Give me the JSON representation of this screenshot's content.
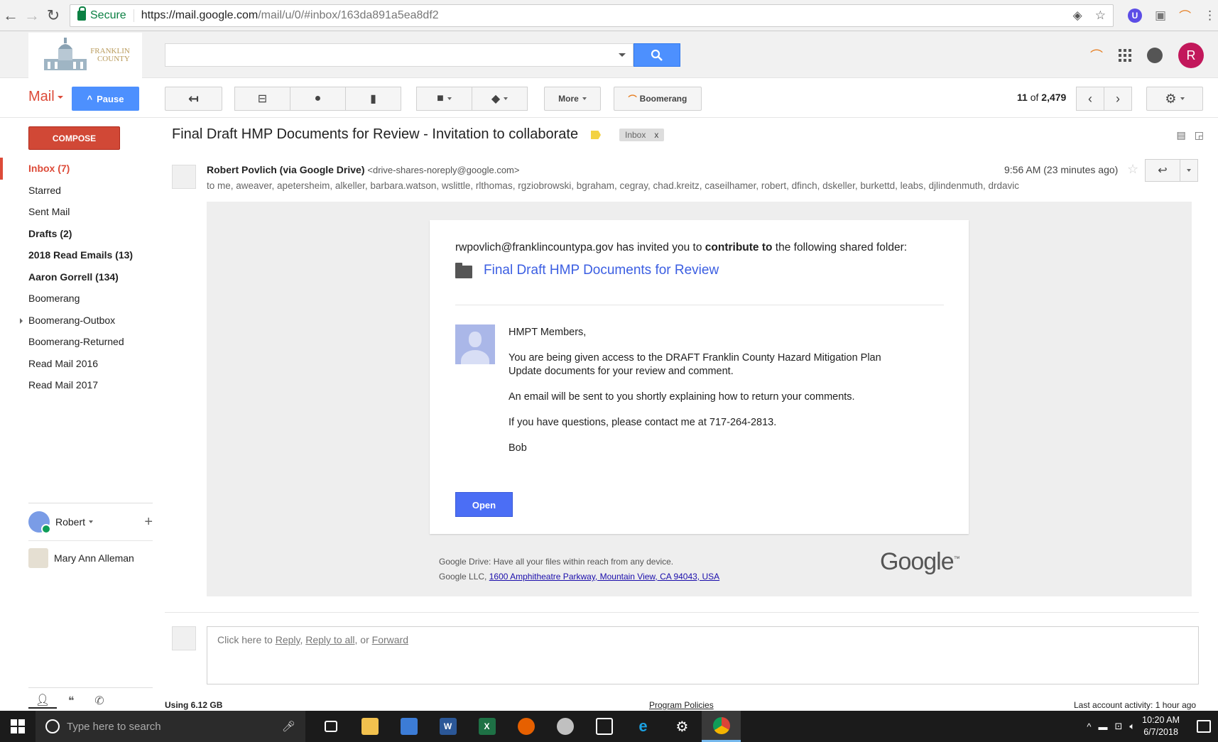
{
  "browser": {
    "secure_label": "Secure",
    "url_host": "https://mail.google.com",
    "url_path": "/mail/u/0/#inbox/163da891a5ea8df2"
  },
  "header": {
    "logo_text_1": "FRANKLIN",
    "logo_text_2": "COUNTY",
    "search_placeholder": "",
    "avatar_letter": "R"
  },
  "toolbar": {
    "mail_label": "Mail",
    "pause_label": "Pause",
    "more_label": "More",
    "boomerang_label": "Boomerang",
    "pager_current": "11",
    "pager_of": "of",
    "pager_total": "2,479"
  },
  "sidebar": {
    "compose_label": "COMPOSE",
    "items": [
      {
        "label": "Inbox (7)"
      },
      {
        "label": "Starred"
      },
      {
        "label": "Sent Mail"
      },
      {
        "label": "Drafts (2)"
      },
      {
        "label": "2018 Read Emails (13)"
      },
      {
        "label": "Aaron Gorrell (134)"
      },
      {
        "label": "Boomerang"
      },
      {
        "label": "Boomerang-Outbox"
      },
      {
        "label": "Boomerang-Returned"
      },
      {
        "label": "Read Mail 2016"
      },
      {
        "label": "Read Mail 2017"
      }
    ],
    "hangouts_user": "Robert",
    "contact_name": "Mary Ann Alleman"
  },
  "message": {
    "subject": "Final Draft HMP Documents for Review - Invitation to collaborate",
    "label_inbox": "Inbox",
    "label_x": "x",
    "sender_name": "Robert Povlich (via Google Drive)",
    "sender_email": "<drive-shares-noreply@google.com>",
    "to_line": "to me, aweaver, apetersheim, alkeller, barbara.watson, wslittle, rlthomas, rgziobrowski, bgraham, cegray, chad.kreitz, caseilhamer, robert, dfinch, dskeller, burkettd, leabs, djlindenmuth, drdavic",
    "time": "9:56 AM (23 minutes ago)"
  },
  "email": {
    "invite_prefix": "rwpovlich@franklincountypa.gov has invited you to ",
    "invite_bold": "contribute to",
    "invite_suffix": " the following shared folder:",
    "folder_name": "Final Draft HMP Documents for Review",
    "greeting": "HMPT Members,",
    "para1": "You are being given access to the DRAFT Franklin County Hazard Mitigation Plan Update documents for your review and comment.",
    "para2": "An email will be sent to you shortly explaining how to return your comments.",
    "para3": "If you have questions, please contact me at 717-264-2813.",
    "signoff": "Bob",
    "open_label": "Open",
    "footer_line1": "Google Drive: Have all your files within reach from any device.",
    "footer_company": "Google LLC,",
    "footer_address": "1600 Amphitheatre Parkway, Mountain View, CA 94043, USA",
    "google_logo": "Google"
  },
  "reply": {
    "prefix": "Click here to ",
    "reply": "Reply",
    "sep1": ", ",
    "reply_all": "Reply to all",
    "sep2": ", or ",
    "forward": "Forward"
  },
  "footer": {
    "usage": "Using 6.12 GB",
    "policies": "Program Policies",
    "activity": "Last account activity: 1 hour ago"
  },
  "taskbar": {
    "search_placeholder": "Type here to search",
    "time": "10:20 AM",
    "date": "6/7/2018"
  },
  "colors": {
    "accent_blue": "#4d90fe",
    "compose_red": "#d14836",
    "link_blue": "#3b5ee2"
  }
}
